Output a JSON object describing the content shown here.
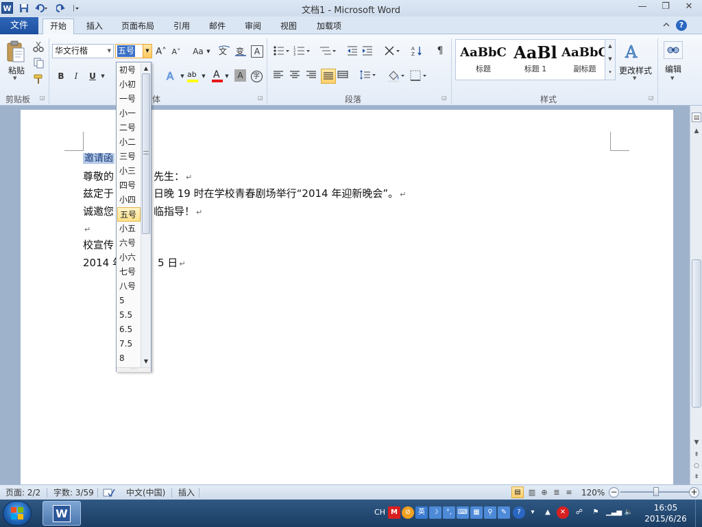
{
  "window": {
    "title": "文档1 - Microsoft Word",
    "app_icon": "W",
    "minimize_glyph": "—",
    "restore_glyph": "❐",
    "close_glyph": "✕"
  },
  "tabs": [
    "文件",
    "开始",
    "插入",
    "页面布局",
    "引用",
    "邮件",
    "审阅",
    "视图",
    "加载项"
  ],
  "ribbon": {
    "clipboard": {
      "paste": "粘贴",
      "label": "剪贴板"
    },
    "font": {
      "font_name": "华文行楷",
      "font_size": "五号",
      "label": "体",
      "grow": "A˄",
      "shrink": "A˅",
      "case": "Aa",
      "clear": "A",
      "bold": "B",
      "italic": "I",
      "underline": "U",
      "highlight": "ab",
      "font_color": "A",
      "shade": "A",
      "encircle": "字"
    },
    "paragraph": {
      "label": "段落"
    },
    "styles": {
      "label": "样式",
      "items": [
        {
          "preview": "AaBbC",
          "name": "标题"
        },
        {
          "preview": "AaBl",
          "name": "标题 1"
        },
        {
          "preview": "AaBbC",
          "name": "副标题"
        }
      ],
      "change": "更改样式"
    },
    "editing": {
      "label": "编辑"
    }
  },
  "size_list": [
    "初号",
    "小初",
    "一号",
    "小一",
    "二号",
    "小二",
    "三号",
    "小三",
    "四号",
    "小四",
    "五号",
    "小五",
    "六号",
    "小六",
    "七号",
    "八号",
    "5",
    "5.5",
    "6.5",
    "7.5",
    "8"
  ],
  "size_selected": "五号",
  "document": {
    "heading": "邀请函",
    "lines": [
      "尊敬的",
      "先生：",
      "兹定于",
      "日晚 19 时在学校青春剧场举行“2014 年迎新晚会”。",
      "诚邀您",
      "临指导！",
      "校宣传",
      "2014 年",
      "5 日"
    ],
    "para_mark": "↵"
  },
  "status": {
    "page": "页面: 2/2",
    "words": "字数: 3/59",
    "language": "中文(中国)",
    "mode": "插入",
    "zoom": "120%",
    "zoom_percent": 120
  },
  "taskbar": {
    "lang": "CH",
    "time": "16:05",
    "date": "2015/6/26"
  },
  "colors": {
    "accent": "#2b579a",
    "selection": "#3a6fc6",
    "highlight_item": "#ffe28a"
  }
}
